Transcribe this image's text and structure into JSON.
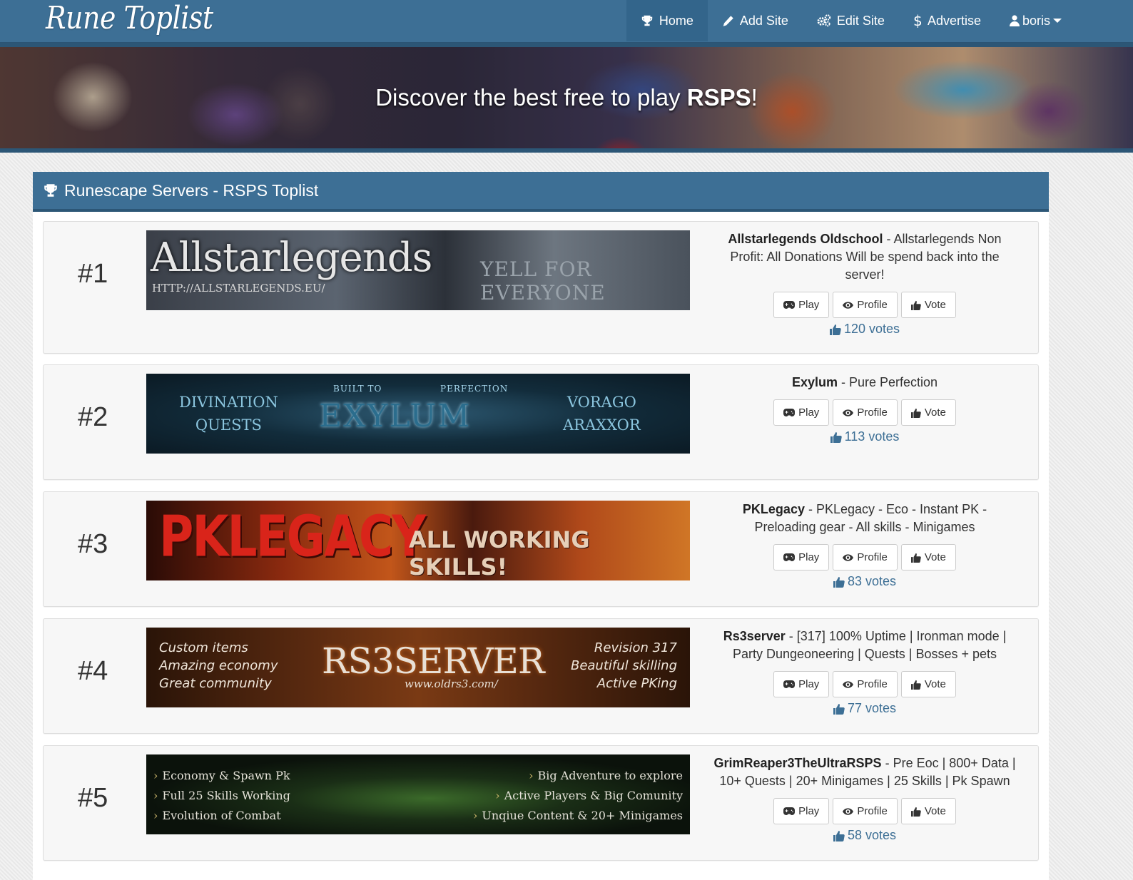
{
  "brand": "Rune Toplist",
  "nav": {
    "items": [
      {
        "label": "Home",
        "icon": "trophy-icon",
        "active": true
      },
      {
        "label": "Add Site",
        "icon": "pencil-icon",
        "active": false
      },
      {
        "label": "Edit Site",
        "icon": "gears-icon",
        "active": false
      },
      {
        "label": "Advertise",
        "icon": "dollar-icon",
        "active": false
      },
      {
        "label": "boris",
        "icon": "user-icon",
        "active": false
      }
    ]
  },
  "hero": {
    "title_prefix": "Discover the best free to play ",
    "title_bold": "RSPS",
    "title_suffix": "!"
  },
  "panel": {
    "title": "Runescape Servers - RSPS Toplist"
  },
  "buttons": {
    "play": "Play",
    "profile": "Profile",
    "vote": "Vote"
  },
  "entries": [
    {
      "rank": "#1",
      "name": "Allstarlegends Oldschool",
      "description": "Allstarlegends Non Profit: All Donations Will be spend back into the server!",
      "votes": "120 votes",
      "banner": {
        "title": "Allstarlegends",
        "url": "HTTP://ALLSTARLEGENDS.EU/",
        "tagline": "YELL FOR EVERYONE"
      }
    },
    {
      "rank": "#2",
      "name": "Exylum",
      "description": "Pure Perfection",
      "votes": "113 votes",
      "banner": {
        "left1": "DIVINATION",
        "left2": "QUESTS",
        "center": "EXYLUM",
        "small1": "BUILT TO",
        "small2": "PERFECTION",
        "right1": "VORAGO",
        "right2": "ARAXXOR"
      }
    },
    {
      "rank": "#3",
      "name": "PKLegacy",
      "description": "PKLegacy - Eco - Instant PK - Preloading gear - All skills - Minigames",
      "votes": "83 votes",
      "banner": {
        "title": "PKLEGACY",
        "tagline": "ALL WORKING SKILLS!"
      }
    },
    {
      "rank": "#4",
      "name": "Rs3server",
      "description": "[317] 100% Uptime | Ironman mode | Party Dungeoneering | Quests | Bosses + pets",
      "votes": "77 votes",
      "banner": {
        "left1": "Custom items",
        "left2": "Amazing economy",
        "left3": "Great community",
        "title": "RS3SERVER",
        "url": "www.oldrs3.com/",
        "right1": "Revision 317",
        "right2": "Beautiful skilling",
        "right3": "Active PKing"
      }
    },
    {
      "rank": "#5",
      "name": "GrimReaper3TheUltraRSPS",
      "description": "Pre Eoc | 800+ Data | 10+ Quests | 20+ Minigames | 25 Skills | Pk Spawn",
      "votes": "58 votes",
      "banner": {
        "left1": "Economy & Spawn Pk",
        "left2": "Full 25 Skills Working",
        "left3": "Evolution of Combat",
        "right1": "Big Adventure to explore",
        "right2": "Active Players & Big Comunity",
        "right3": "Unqiue Content & 20+ Minigames"
      }
    }
  ]
}
